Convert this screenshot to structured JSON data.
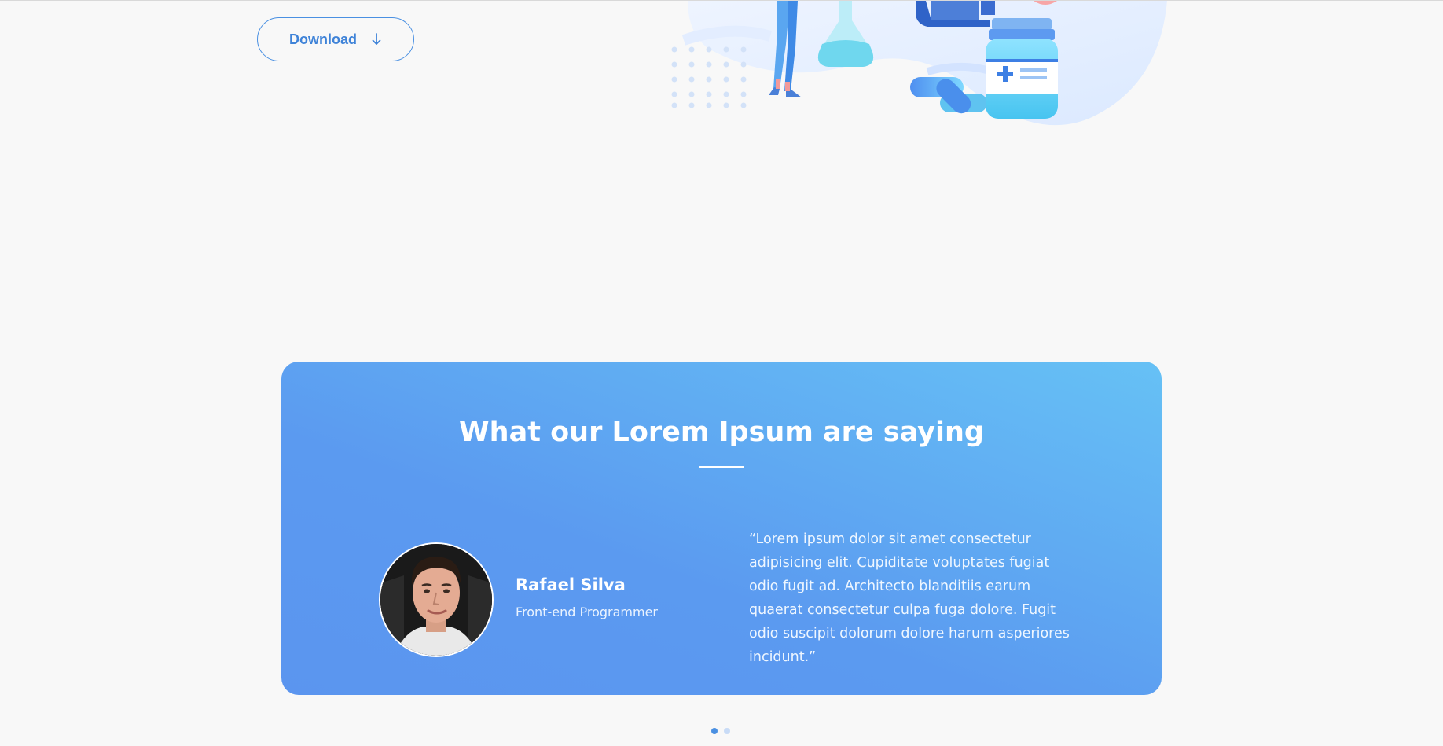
{
  "hero": {
    "download_label": "Download",
    "download_icon": "arrow-down-icon"
  },
  "testimonials": {
    "title": "What our Lorem Ipsum are saying",
    "current": {
      "name": "Rafael Silva",
      "role": "Front-end Programmer",
      "quote": "“Lorem ipsum dolor sit amet consectetur adipisicing elit. Cupiditate voluptates fugiat odio fugit ad. Architecto blanditiis earum quaerat consectetur culpa fuga dolore. Fugit odio suscipit dolorum dolore harum asperiores incidunt.”"
    },
    "slide_count": 2,
    "active_slide": 1
  },
  "colors": {
    "accent": "#4a90e2",
    "card_gradient_start": "#5b95ef",
    "card_gradient_end": "#66c1f5",
    "background": "#f8f8f8"
  }
}
